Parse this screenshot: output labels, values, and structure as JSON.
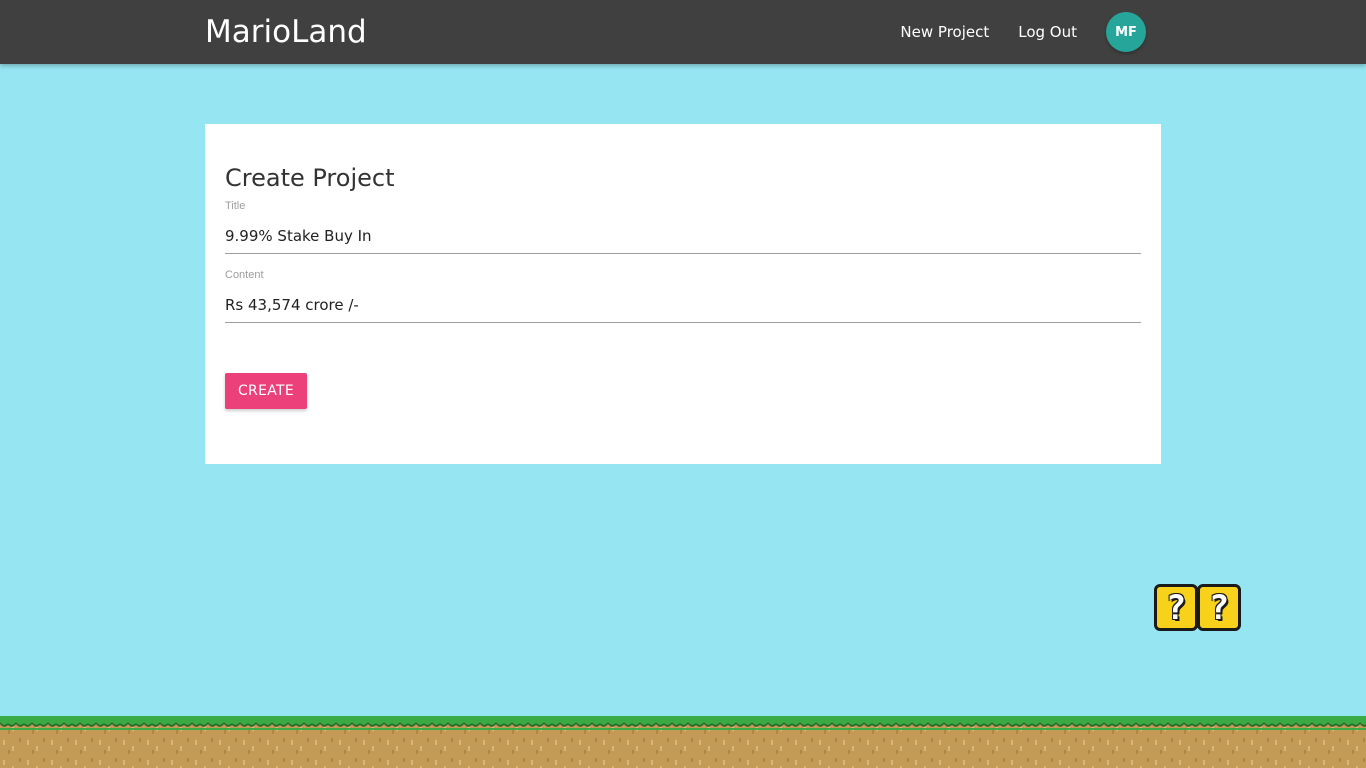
{
  "nav": {
    "brand": "MarioLand",
    "links": [
      {
        "label": "New Project"
      },
      {
        "label": "Log Out"
      }
    ],
    "avatar_initials": "MF",
    "avatar_color": "#26a69a"
  },
  "form": {
    "heading": "Create Project",
    "title_label": "Title",
    "title_value": "9.99% Stake Buy In",
    "content_label": "Content",
    "content_value": "Rs 43,574 crore /-",
    "submit_label": "CREATE",
    "submit_color": "#ec407a"
  },
  "decor": {
    "question_blocks": [
      {
        "glyph": "?"
      },
      {
        "glyph": "?"
      }
    ],
    "sky_color": "#95e6f2",
    "grass_color": "#3aaa45",
    "dirt_color": "#c49a57"
  }
}
